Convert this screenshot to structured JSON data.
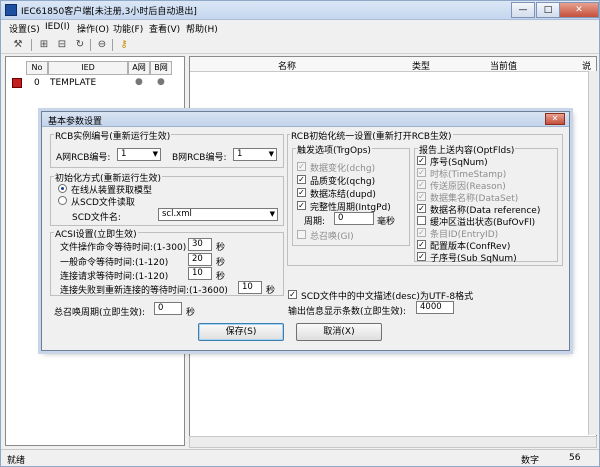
{
  "window": {
    "title": "IEC61850客户端[未注册,3小时后自动退出]",
    "min": "—",
    "max": "□",
    "close": "✕"
  },
  "menu": [
    "设置(S)",
    "IED(I)",
    "操作(O)",
    "功能(F)",
    "查看(V)",
    "帮助(H)"
  ],
  "toolbar_icons": [
    "hammer-icon",
    "tree-icon",
    "tree-alt-icon",
    "refresh-icon",
    "minus-circle-icon",
    "key-icon"
  ],
  "tree": {
    "headers": [
      "No",
      "IED",
      "A网",
      "B网"
    ],
    "row": {
      "no": "0",
      "name": "TEMPLATE",
      "a": "●",
      "b": "●"
    }
  },
  "list_headers": [
    "名称",
    "类型",
    "当前值",
    "说"
  ],
  "status": {
    "left": "就绪",
    "mode": "数字",
    "num": "56"
  },
  "dialog": {
    "title": "基本参数设置",
    "close": "✕",
    "rcb": {
      "title": "RCB实例编号(重新运行生效)",
      "a_label": "A网RCB编号:",
      "a_value": "1",
      "b_label": "B网RCB编号:",
      "b_value": "1"
    },
    "init": {
      "title": "初始化方式(重新运行生效)",
      "opt1": "在线从装置获取模型",
      "opt2": "从SCD文件读取",
      "scd_label": "SCD文件名:",
      "scd_value": "scl.xml"
    },
    "acsi": {
      "title": "ACSI设置(立即生效)",
      "rows": [
        {
          "label": "文件操作命令等待时间:(1-300)",
          "value": "30",
          "unit": "秒"
        },
        {
          "label": "一般命令等待时间:(1-120)",
          "value": "20",
          "unit": "秒"
        },
        {
          "label": "连接请求等待时间:(1-120)",
          "value": "10",
          "unit": "秒"
        },
        {
          "label": "连接失败到重新连接的等待时间:(1-3600)",
          "value": "10",
          "unit": "秒"
        }
      ]
    },
    "gi": {
      "label": "总召唤周期(立即生效):",
      "value": "0",
      "unit": "秒"
    },
    "rcbinit": {
      "title": "RCB初始化统一设置(重新打开RCB生效)",
      "trg": {
        "title": "触发选项(TrgOps)",
        "items": [
          {
            "label": "数据变化(dchg)",
            "checked": true,
            "disabled": true
          },
          {
            "label": "品质变化(qchg)",
            "checked": true,
            "disabled": false
          },
          {
            "label": "数据冻结(dupd)",
            "checked": true,
            "disabled": false
          },
          {
            "label": "完整性周期(IntgPd)",
            "checked": true,
            "disabled": false
          }
        ],
        "period_label": "周期:",
        "period_value": "0",
        "period_unit": "毫秒",
        "gi_label": "总召唤(GI)"
      },
      "opt": {
        "title": "报告上送内容(OptFlds)",
        "items": [
          {
            "label": "序号(SqNum)",
            "checked": true,
            "disabled": false
          },
          {
            "label": "时标(TimeStamp)",
            "checked": true,
            "disabled": true
          },
          {
            "label": "传送原因(Reason)",
            "checked": true,
            "disabled": true
          },
          {
            "label": "数据集名称(DataSet)",
            "checked": true,
            "disabled": true
          },
          {
            "label": "数据名称(Data reference)",
            "checked": true,
            "disabled": false
          },
          {
            "label": "缓冲区溢出状态(BufOvFl)",
            "checked": false,
            "disabled": false
          },
          {
            "label": "条目ID(EntryID)",
            "checked": true,
            "disabled": true
          },
          {
            "label": "配置版本(ConfRev)",
            "checked": true,
            "disabled": false
          },
          {
            "label": "子序号(Sub SqNum)",
            "checked": true,
            "disabled": false
          }
        ]
      }
    },
    "utf8": {
      "label": "SCD文件中的中文描述(desc)为UTF-8格式",
      "checked": true
    },
    "maxout": {
      "label": "输出信息显示条数(立即生效):",
      "value": "4000"
    },
    "save": "保存(S)",
    "cancel": "取消(X)"
  }
}
